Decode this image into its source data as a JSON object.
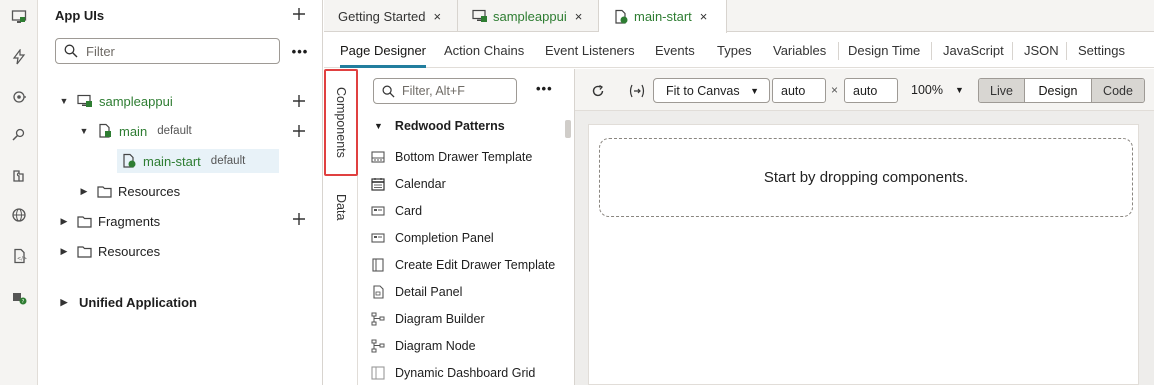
{
  "iconbar": {
    "items": [
      "monitor-icon",
      "bolt-icon",
      "service-icon",
      "process-icon",
      "component-icon",
      "globe-icon",
      "document-icon",
      "help-badge-icon"
    ]
  },
  "explorer": {
    "title": "App UIs",
    "filter_placeholder": "Filter",
    "more_label": "•••",
    "tree": {
      "app": "sampleappui",
      "flow": "main",
      "flow_sub": "default",
      "page": "main-start",
      "page_sub": "default",
      "resources_inner": "Resources",
      "fragments": "Fragments",
      "resources": "Resources",
      "unified": "Unified Application"
    }
  },
  "tabs": [
    {
      "label": "Getting Started",
      "close": "×"
    },
    {
      "label": "sampleappui",
      "close": "×"
    },
    {
      "label": "main-start",
      "close": "×"
    }
  ],
  "subtabs": [
    "Page Designer",
    "Action Chains",
    "Event Listeners",
    "Events",
    "Types",
    "Variables",
    "Design Time",
    "JavaScript",
    "JSON",
    "Settings"
  ],
  "vtabs": [
    "Components",
    "Data"
  ],
  "palette": {
    "filter_placeholder": "Filter, Alt+F",
    "more_label": "•••",
    "group": "Redwood Patterns",
    "items": [
      "Bottom Drawer Template",
      "Calendar",
      "Card",
      "Completion Panel",
      "Create Edit Drawer Template",
      "Detail Panel",
      "Diagram Builder",
      "Diagram Node",
      "Dynamic Dashboard Grid"
    ]
  },
  "canvas_toolbar": {
    "fit": "Fit to Canvas",
    "width": "auto",
    "height": "auto",
    "times": "×",
    "zoom": "100%",
    "modes": [
      "Live",
      "Design",
      "Code"
    ],
    "active_mode": "Design"
  },
  "canvas": {
    "drop_text": "Start by dropping components."
  },
  "colors": {
    "accent": "#227e9e",
    "highlight": "#e04040",
    "app_green": "#2e7d32"
  }
}
